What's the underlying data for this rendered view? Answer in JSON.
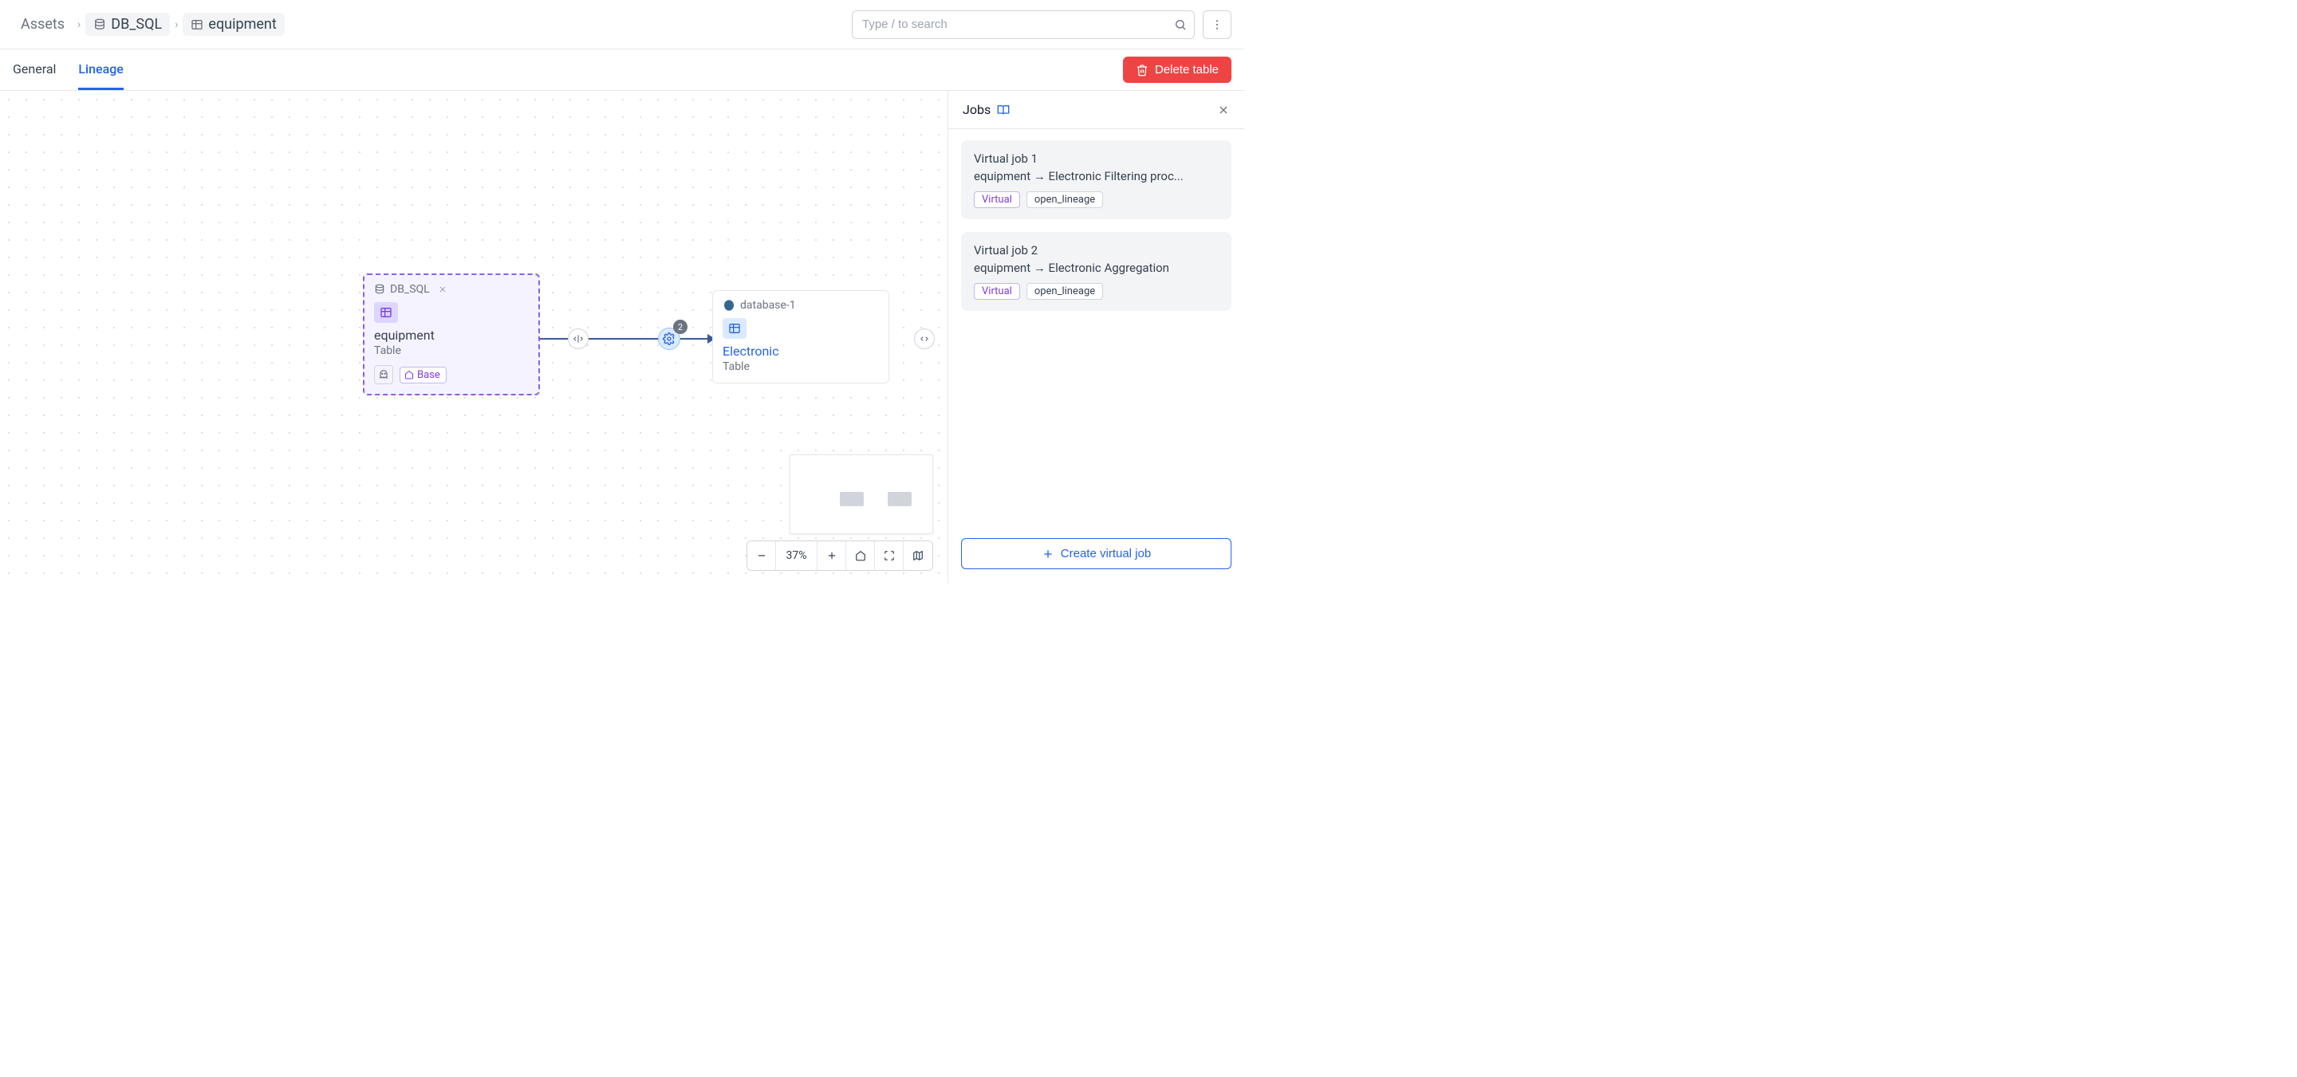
{
  "breadcrumb": {
    "root": "Assets",
    "db": "DB_SQL",
    "item": "equipment"
  },
  "search": {
    "placeholder": "Type / to search"
  },
  "tabs": {
    "general": "General",
    "lineage": "Lineage"
  },
  "actions": {
    "delete": "Delete table"
  },
  "lineage": {
    "source": {
      "group": "DB_SQL",
      "name": "equipment",
      "type": "Table",
      "base_label": "Base"
    },
    "target": {
      "group": "database-1",
      "name": "Electronic",
      "type": "Table"
    },
    "edge": {
      "count": "2"
    }
  },
  "zoom": {
    "level": "37%"
  },
  "sidepanel": {
    "title": "Jobs",
    "jobs": [
      {
        "name": "Virtual job 1",
        "desc": "equipment → Electronic Filtering proc...",
        "tags": {
          "virtual": "Virtual",
          "kind": "open_lineage"
        }
      },
      {
        "name": "Virtual job 2",
        "desc": "equipment → Electronic Aggregation",
        "tags": {
          "virtual": "Virtual",
          "kind": "open_lineage"
        }
      }
    ],
    "create": "Create virtual job"
  }
}
